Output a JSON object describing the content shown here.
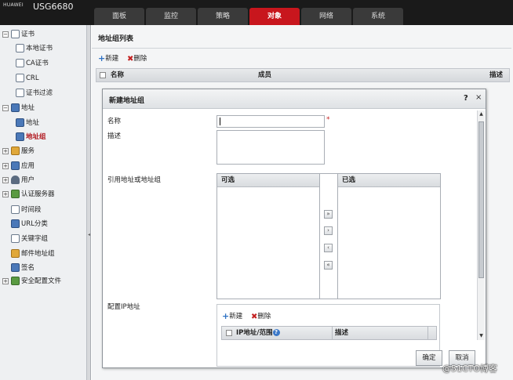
{
  "app": {
    "brand": "HUAWEI",
    "model": "USG6680"
  },
  "tabs": [
    {
      "label": "面板"
    },
    {
      "label": "监控"
    },
    {
      "label": "策略"
    },
    {
      "label": "对象",
      "active": true
    },
    {
      "label": "网络"
    },
    {
      "label": "系统"
    }
  ],
  "sidebar": {
    "items": [
      {
        "label": "证书",
        "icon": "certificate-icon",
        "expander": "−"
      },
      {
        "label": "本地证书",
        "icon": "local-cert-icon"
      },
      {
        "label": "CA证书",
        "icon": "ca-cert-icon"
      },
      {
        "label": "CRL",
        "icon": "crl-icon"
      },
      {
        "label": "证书过滤",
        "icon": "cert-filter-icon"
      },
      {
        "label": "地址",
        "icon": "address-icon",
        "expander": "−"
      },
      {
        "label": "地址",
        "icon": "address-item-icon"
      },
      {
        "label": "地址组",
        "icon": "address-group-icon",
        "selected": true
      },
      {
        "label": "服务",
        "icon": "service-icon",
        "expander": "+"
      },
      {
        "label": "应用",
        "icon": "application-icon",
        "expander": "+"
      },
      {
        "label": "用户",
        "icon": "user-icon",
        "expander": "+"
      },
      {
        "label": "认证服务器",
        "icon": "auth-server-icon",
        "expander": "+"
      },
      {
        "label": "时间段",
        "icon": "time-range-icon"
      },
      {
        "label": "URL分类",
        "icon": "url-category-icon"
      },
      {
        "label": "关键字组",
        "icon": "keyword-group-icon"
      },
      {
        "label": "邮件地址组",
        "icon": "mail-address-group-icon"
      },
      {
        "label": "签名",
        "icon": "signature-icon"
      },
      {
        "label": "安全配置文件",
        "icon": "security-profile-icon",
        "expander": "+"
      }
    ]
  },
  "main": {
    "title": "地址组列表",
    "toolbar": {
      "new_label": "新建",
      "delete_label": "删除"
    },
    "columns": {
      "name": "名称",
      "members": "成员",
      "description": "描述"
    }
  },
  "dialog": {
    "title": "新建地址组",
    "help": "?",
    "close": "×",
    "name_label": "名称",
    "required_mark": "*",
    "description_label": "描述",
    "reference_label": "引用地址或地址组",
    "available_header": "可选",
    "selected_header": "已选",
    "move_buttons": {
      "add_all": "»",
      "add": "›",
      "remove": "‹",
      "remove_all": "«"
    },
    "config_ip_label": "配置IP地址",
    "ip_toolbar": {
      "new_label": "新建",
      "delete_label": "删除"
    },
    "ip_columns": {
      "address": "IP地址/范围",
      "description": "描述"
    },
    "ok_label": "确定",
    "cancel_label": "取消"
  },
  "watermark": "@51CTO博客"
}
